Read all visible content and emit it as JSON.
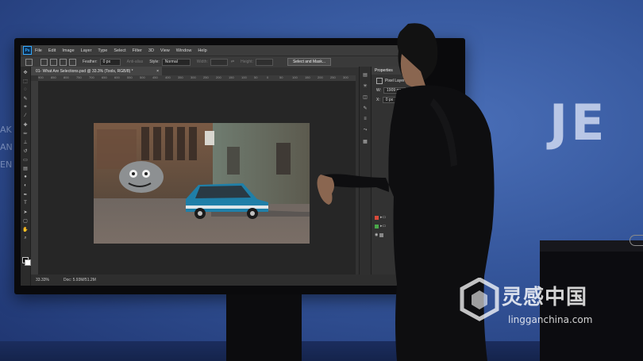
{
  "backdrop": {
    "wordmark": "JE",
    "left_fragments": [
      "AK",
      "AN",
      "EN"
    ]
  },
  "menubar": {
    "logo": "Ps",
    "items": [
      "File",
      "Edit",
      "Image",
      "Layer",
      "Type",
      "Select",
      "Filter",
      "3D",
      "View",
      "Window",
      "Help"
    ]
  },
  "options": {
    "feather_label": "Feather:",
    "feather_value": "0 px",
    "anti_alias": "Anti-alias",
    "style_label": "Style:",
    "style_value": "Normal",
    "width_label": "Width:",
    "height_label": "Height:",
    "select_mask": "Select and Mask..."
  },
  "document": {
    "tab_title": "01- What Are Selections.psd @ 33.3% (Tools, RGB/8) *",
    "close": "×",
    "ruler_ticks": [
      "900",
      "850",
      "800",
      "750",
      "700",
      "650",
      "600",
      "550",
      "500",
      "450",
      "400",
      "350",
      "300",
      "250",
      "200",
      "150",
      "100",
      "50",
      "0",
      "50",
      "100",
      "150",
      "200",
      "250",
      "300"
    ]
  },
  "status": {
    "zoom": "33.33%",
    "doc": "Doc: 5.93M/51.2M"
  },
  "properties": {
    "tab": "Properties",
    "layer_type": "Pixel Layer",
    "w_label": "W:",
    "w_value": "1909 px",
    "x_label": "X:",
    "x_value": "0 px"
  },
  "colors": {
    "accent": "#31a8ff",
    "layer_red": "#d94a3a",
    "layer_green": "#4aa84a"
  },
  "icons": [
    "move-icon",
    "marquee-icon",
    "lasso-icon",
    "quick-select-icon",
    "crop-icon",
    "eyedropper-icon",
    "healing-icon",
    "brush-icon",
    "stamp-icon",
    "history-brush-icon",
    "eraser-icon",
    "gradient-icon",
    "blur-icon",
    "dodge-icon",
    "pen-icon",
    "type-icon",
    "path-select-icon",
    "shape-icon",
    "hand-icon",
    "zoom-icon"
  ],
  "watermark": {
    "cn": "灵感中国",
    "url": "lingganchina.com"
  }
}
